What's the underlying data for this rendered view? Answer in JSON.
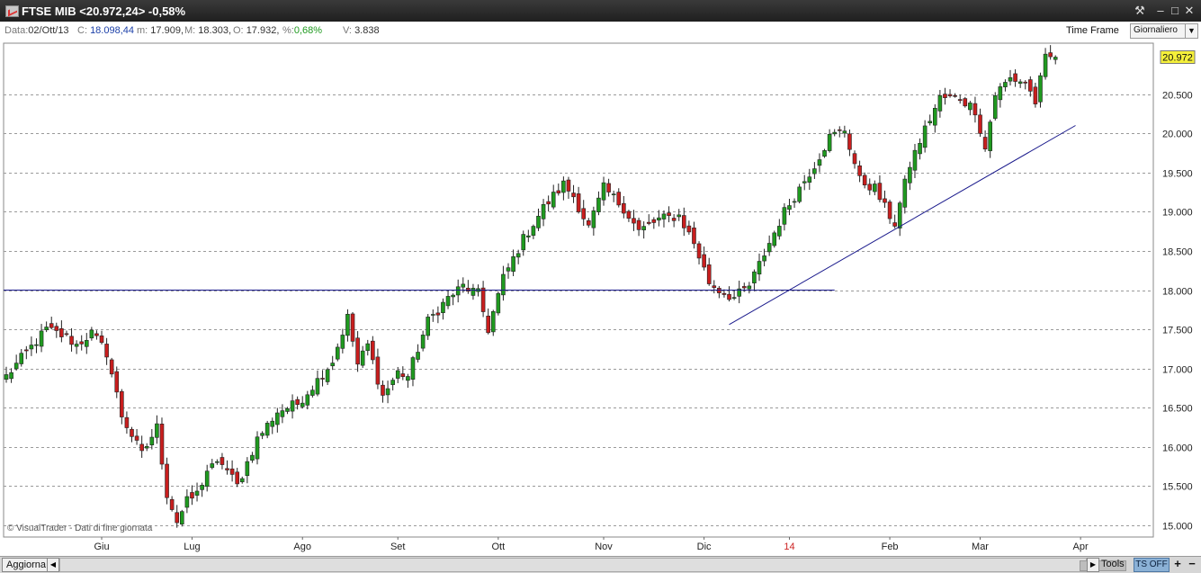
{
  "window": {
    "title": "FTSE MIB <20.972,24> -0,58%",
    "buttons": {
      "settings": "⚒",
      "minimize": "–",
      "restore": "□",
      "close": "✕"
    }
  },
  "infobar": {
    "date_label": "Data:",
    "date_value": "02/Ott/13",
    "close_label": "C:",
    "close_value": "18.098,44",
    "min_label": "m:",
    "min_value": "17.909,",
    "max_label": "M:",
    "max_value": "18.303,",
    "open_label": "O:",
    "open_value": "17.932,",
    "pct_label": "%:",
    "pct_value": "0,68%",
    "vol_label": "V:",
    "vol_value": "3.838"
  },
  "timeframe": {
    "label": "Time Frame",
    "selected": "Giornaliero"
  },
  "chart_data": {
    "type": "candlestick",
    "watermark": "© VisualTrader - Dati di fine giornata",
    "y_ticks": [
      15000,
      15500,
      16000,
      16500,
      17000,
      17500,
      18000,
      18500,
      19000,
      19500,
      20000,
      20500
    ],
    "y_tick_labels": [
      "15.000",
      "15.500",
      "16.000",
      "16.500",
      "17.000",
      "17.500",
      "18.000",
      "18.500",
      "19.000",
      "19.500",
      "20.000",
      "20.500"
    ],
    "ylim": [
      14850,
      21150
    ],
    "x_labels": [
      {
        "label": "Giu",
        "i": 19
      },
      {
        "label": "Lug",
        "i": 37
      },
      {
        "label": "Ago",
        "i": 59
      },
      {
        "label": "Set",
        "i": 78
      },
      {
        "label": "Ott",
        "i": 98
      },
      {
        "label": "Nov",
        "i": 119
      },
      {
        "label": "Dic",
        "i": 139
      },
      {
        "label": "14",
        "i": 156,
        "color": "#cc2222"
      },
      {
        "label": "Feb",
        "i": 176
      },
      {
        "label": "Mar",
        "i": 194
      },
      {
        "label": "Apr",
        "i": 214
      }
    ],
    "last_price_label": "20.972",
    "last_price": 20972,
    "horizontal_line": {
      "value": 18000,
      "from_i": 0,
      "to_i": 165
    },
    "trendline": {
      "from": {
        "i": 144,
        "v": 17560
      },
      "to": {
        "i": 213,
        "v": 20100
      }
    },
    "series": {
      "name": "FTSE MIB",
      "anchors": [
        [
          0,
          16900
        ],
        [
          4,
          17200
        ],
        [
          8,
          17500
        ],
        [
          12,
          17400
        ],
        [
          14,
          17300
        ],
        [
          17,
          17450
        ],
        [
          20,
          17200
        ],
        [
          23,
          16400
        ],
        [
          27,
          15900
        ],
        [
          30,
          16250
        ],
        [
          32,
          15400
        ],
        [
          34,
          15050
        ],
        [
          36,
          15300
        ],
        [
          38,
          15400
        ],
        [
          40,
          15700
        ],
        [
          43,
          15800
        ],
        [
          46,
          15500
        ],
        [
          50,
          16100
        ],
        [
          54,
          16450
        ],
        [
          58,
          16550
        ],
        [
          62,
          16850
        ],
        [
          65,
          17100
        ],
        [
          68,
          17650
        ],
        [
          70,
          17050
        ],
        [
          72,
          17300
        ],
        [
          75,
          16650
        ],
        [
          78,
          16950
        ],
        [
          80,
          16900
        ],
        [
          84,
          17600
        ],
        [
          88,
          17900
        ],
        [
          91,
          18050
        ],
        [
          94,
          17950
        ],
        [
          96,
          17500
        ],
        [
          99,
          18150
        ],
        [
          103,
          18650
        ],
        [
          107,
          19050
        ],
        [
          111,
          19350
        ],
        [
          113,
          19200
        ],
        [
          116,
          18800
        ],
        [
          119,
          19300
        ],
        [
          123,
          19050
        ],
        [
          126,
          18750
        ],
        [
          130,
          18900
        ],
        [
          134,
          18950
        ],
        [
          137,
          18600
        ],
        [
          140,
          18100
        ],
        [
          142,
          18000
        ],
        [
          145,
          17900
        ],
        [
          148,
          18050
        ],
        [
          152,
          18600
        ],
        [
          155,
          19000
        ],
        [
          158,
          19300
        ],
        [
          161,
          19600
        ],
        [
          164,
          19950
        ],
        [
          167,
          20050
        ],
        [
          170,
          19400
        ],
        [
          173,
          19300
        ],
        [
          175,
          19050
        ],
        [
          177,
          18850
        ],
        [
          180,
          19600
        ],
        [
          183,
          20050
        ],
        [
          186,
          20450
        ],
        [
          190,
          20450
        ],
        [
          193,
          20300
        ],
        [
          195,
          19800
        ],
        [
          197,
          20500
        ],
        [
          200,
          20700
        ],
        [
          203,
          20650
        ],
        [
          205,
          20400
        ],
        [
          207,
          20950
        ],
        [
          209,
          20972
        ]
      ],
      "count": 210
    }
  },
  "statusbar": {
    "refresh": "Aggiorna",
    "tools": "Tools",
    "ts": "TS OFF",
    "zoom_in": "+",
    "zoom_out": "−"
  }
}
